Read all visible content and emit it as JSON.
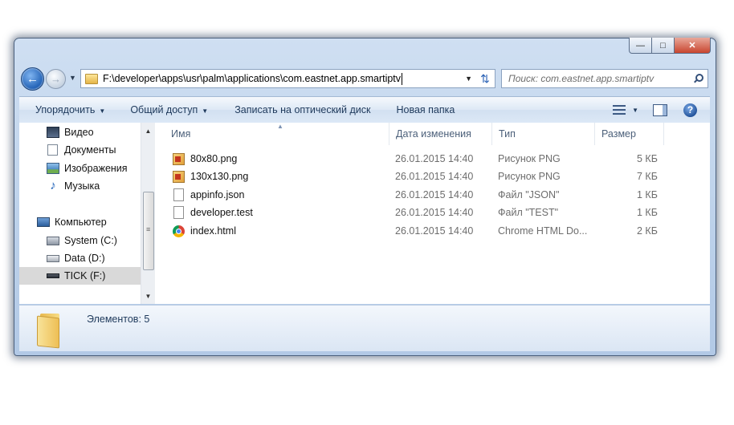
{
  "window": {
    "minimize_label": "▭",
    "maximize_label": "▣",
    "close_label": "✕"
  },
  "nav": {
    "address_path": "F:\\developer\\apps\\usr\\palm\\applications\\com.eastnet.app.smartiptv",
    "search_placeholder": "Поиск: com.eastnet.app.smartiptv"
  },
  "toolbar": {
    "organize_label": "Упорядочить",
    "share_label": "Общий доступ",
    "burn_label": "Записать на оптический диск",
    "new_folder_label": "Новая папка"
  },
  "sidebar": {
    "items": [
      {
        "label": "Видео",
        "icon": "video-icon"
      },
      {
        "label": "Документы",
        "icon": "documents-icon"
      },
      {
        "label": "Изображения",
        "icon": "pictures-icon"
      },
      {
        "label": "Музыка",
        "icon": "music-icon"
      },
      {
        "label": "Компьютер",
        "icon": "computer-icon"
      },
      {
        "label": "System (C:)",
        "icon": "system-drive-icon"
      },
      {
        "label": "Data (D:)",
        "icon": "drive-icon"
      },
      {
        "label": "TICK (F:)",
        "icon": "usb-drive-icon",
        "selected": true
      }
    ]
  },
  "columns": {
    "name": "Имя",
    "date": "Дата изменения",
    "type": "Тип",
    "size": "Размер"
  },
  "files": [
    {
      "name": "80x80.png",
      "date": "26.01.2015 14:40",
      "type": "Рисунок PNG",
      "size": "5 КБ",
      "icon": "png-file-icon"
    },
    {
      "name": "130x130.png",
      "date": "26.01.2015 14:40",
      "type": "Рисунок PNG",
      "size": "7 КБ",
      "icon": "png-file-icon"
    },
    {
      "name": "appinfo.json",
      "date": "26.01.2015 14:40",
      "type": "Файл \"JSON\"",
      "size": "1 КБ",
      "icon": "file-icon"
    },
    {
      "name": "developer.test",
      "date": "26.01.2015 14:40",
      "type": "Файл \"TEST\"",
      "size": "1 КБ",
      "icon": "file-icon"
    },
    {
      "name": "index.html",
      "date": "26.01.2015 14:40",
      "type": "Chrome HTML Do...",
      "size": "2 КБ",
      "icon": "chrome-file-icon"
    }
  ],
  "details": {
    "count_text": "Элементов: 5"
  }
}
